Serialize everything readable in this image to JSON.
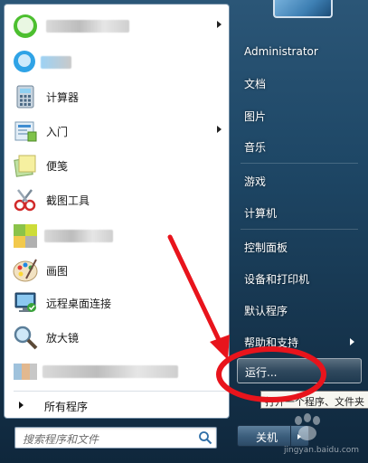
{
  "left_pane": {
    "programs": [
      {
        "name": "",
        "label": "",
        "has_arrow": true
      },
      {
        "name": "",
        "label": "",
        "has_arrow": false
      },
      {
        "name": "calculator",
        "label": "计算器",
        "has_arrow": false
      },
      {
        "name": "getting-started",
        "label": "入门",
        "has_arrow": true
      },
      {
        "name": "sticky-notes",
        "label": "便笺",
        "has_arrow": false
      },
      {
        "name": "snipping-tool",
        "label": "截图工具",
        "has_arrow": false
      },
      {
        "name": "",
        "label": "",
        "has_arrow": false
      },
      {
        "name": "paint",
        "label": "画图",
        "has_arrow": false
      },
      {
        "name": "remote-desktop",
        "label": "远程桌面连接",
        "has_arrow": false
      },
      {
        "name": "magnifier",
        "label": "放大镜",
        "has_arrow": false
      },
      {
        "name": "",
        "label": "",
        "has_arrow": false
      }
    ],
    "all_programs": "所有程序",
    "search_placeholder": "搜索程序和文件"
  },
  "right_pane": {
    "items": [
      {
        "label": "Administrator"
      },
      {
        "label": "文档"
      },
      {
        "label": "图片"
      },
      {
        "label": "音乐"
      },
      {
        "label": "游戏"
      },
      {
        "label": "计算机"
      },
      {
        "label": "控制面板"
      },
      {
        "label": "设备和打印机"
      },
      {
        "label": "默认程序"
      },
      {
        "label": "帮助和支持"
      }
    ],
    "run": "运行...",
    "tooltip": "打开一个程序、文件夹",
    "shutdown": "关机"
  },
  "watermark": "jingyan.baidu.com",
  "colors": {
    "annotation_red": "#e8141c",
    "menu_dark": "#16354e"
  }
}
